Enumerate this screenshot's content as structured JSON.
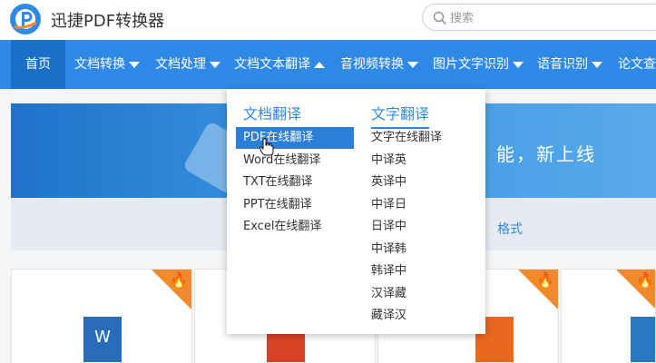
{
  "app": {
    "title": "迅捷PDF转换器"
  },
  "search": {
    "placeholder": "搜索"
  },
  "nav": {
    "items": [
      {
        "label": "首页"
      },
      {
        "label": "文档转换"
      },
      {
        "label": "文档处理"
      },
      {
        "label": "文档文本翻译"
      },
      {
        "label": "音视频转换"
      },
      {
        "label": "图片文字识别"
      },
      {
        "label": "语音识别"
      },
      {
        "label": "论文查"
      }
    ]
  },
  "banner": {
    "text": "能，新上线"
  },
  "subbar": {
    "text": "格式"
  },
  "dropdown": {
    "doc_title": "文档翻译",
    "doc_items": [
      "PDF在线翻译",
      "Word在线翻译",
      "TXT在线翻译",
      "PPT在线翻译",
      "Excel在线翻译"
    ],
    "text_title": "文字翻译",
    "text_items": [
      "文字在线翻译",
      "中译英",
      "英译中",
      "中译日",
      "日译中",
      "中译韩",
      "韩译中",
      "汉译藏",
      "藏译汉"
    ]
  },
  "cards": {
    "word_letter": "W"
  },
  "colors": {
    "primary": "#2e8ae6",
    "nav_active": "#1a6fc8",
    "hot_corner": "#f08a2c"
  },
  "icons": [
    "logo-icon",
    "search-icon",
    "chevron-down-icon",
    "chevron-up-icon",
    "flame-icon",
    "word-file-icon",
    "pdf-file-icon",
    "ppt-file-icon",
    "hand-cursor-icon"
  ]
}
